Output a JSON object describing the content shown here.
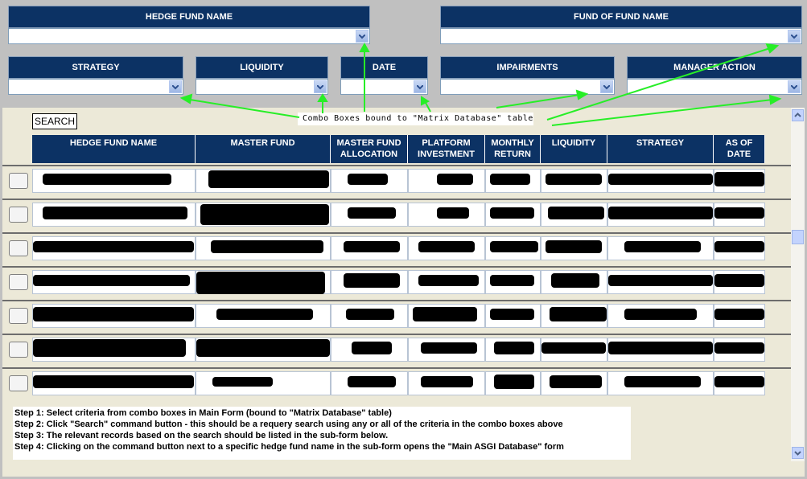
{
  "top_filters": [
    {
      "label": "HEDGE FUND NAME",
      "value": ""
    },
    {
      "label": "FUND OF FUND NAME",
      "value": ""
    }
  ],
  "filters": [
    {
      "label": "STRATEGY",
      "value": ""
    },
    {
      "label": "LIQUIDITY",
      "value": ""
    },
    {
      "label": "DATE",
      "value": ""
    },
    {
      "label": "IMPAIRMENTS",
      "value": ""
    },
    {
      "label": "MANAGER ACTION",
      "value": ""
    }
  ],
  "annotation": "Combo Boxes bound to \"Matrix Database\" table",
  "search_label": "SEARCH",
  "columns": [
    "HEDGE FUND NAME",
    "MASTER FUND",
    "MASTER FUND ALLOCATION",
    "PLATFORM INVESTMENT",
    "MONTHLY RETURN",
    "LIQUIDITY",
    "STRATEGY",
    "AS OF DATE"
  ],
  "rows": [
    {
      "redacted": true
    },
    {
      "redacted": true
    },
    {
      "redacted": true
    },
    {
      "redacted": true
    },
    {
      "redacted": true
    },
    {
      "redacted": true
    },
    {
      "redacted": true
    }
  ],
  "steps": [
    {
      "label": "Step 1:",
      "text": "Select criteria from combo boxes in Main Form (bound to \"Matrix Database\" table)"
    },
    {
      "label": "Step 2:",
      "text": "Click \"Search\" command button - this should be a requery search using any or all of the criteria in the combo boxes above"
    },
    {
      "label": "Step 3:",
      "text": "The relevant records based on the search should be listed in the sub-form below."
    },
    {
      "label": "Step 4:",
      "text": "Clicking on the command button next to a specific hedge fund name in the sub-form opens the \"Main ASGI Database\" form"
    }
  ],
  "colors": {
    "header": "#0c3264",
    "arrow": "#27ee27",
    "panel": "#ece9d8",
    "background": "#c0c0c0"
  }
}
